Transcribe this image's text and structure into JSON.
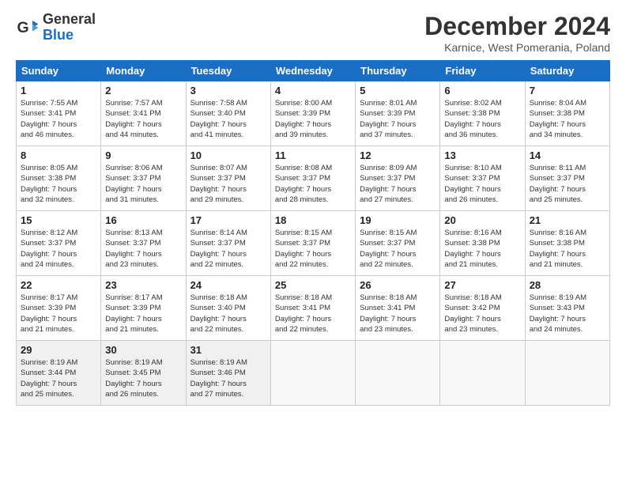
{
  "header": {
    "logo_line1": "General",
    "logo_line2": "Blue",
    "month_title": "December 2024",
    "location": "Karnice, West Pomerania, Poland"
  },
  "days_of_week": [
    "Sunday",
    "Monday",
    "Tuesday",
    "Wednesday",
    "Thursday",
    "Friday",
    "Saturday"
  ],
  "weeks": [
    [
      {
        "day": "1",
        "text": "Sunrise: 7:55 AM\nSunset: 3:41 PM\nDaylight: 7 hours\nand 46 minutes."
      },
      {
        "day": "2",
        "text": "Sunrise: 7:57 AM\nSunset: 3:41 PM\nDaylight: 7 hours\nand 44 minutes."
      },
      {
        "day": "3",
        "text": "Sunrise: 7:58 AM\nSunset: 3:40 PM\nDaylight: 7 hours\nand 41 minutes."
      },
      {
        "day": "4",
        "text": "Sunrise: 8:00 AM\nSunset: 3:39 PM\nDaylight: 7 hours\nand 39 minutes."
      },
      {
        "day": "5",
        "text": "Sunrise: 8:01 AM\nSunset: 3:39 PM\nDaylight: 7 hours\nand 37 minutes."
      },
      {
        "day": "6",
        "text": "Sunrise: 8:02 AM\nSunset: 3:38 PM\nDaylight: 7 hours\nand 36 minutes."
      },
      {
        "day": "7",
        "text": "Sunrise: 8:04 AM\nSunset: 3:38 PM\nDaylight: 7 hours\nand 34 minutes."
      }
    ],
    [
      {
        "day": "8",
        "text": "Sunrise: 8:05 AM\nSunset: 3:38 PM\nDaylight: 7 hours\nand 32 minutes."
      },
      {
        "day": "9",
        "text": "Sunrise: 8:06 AM\nSunset: 3:37 PM\nDaylight: 7 hours\nand 31 minutes."
      },
      {
        "day": "10",
        "text": "Sunrise: 8:07 AM\nSunset: 3:37 PM\nDaylight: 7 hours\nand 29 minutes."
      },
      {
        "day": "11",
        "text": "Sunrise: 8:08 AM\nSunset: 3:37 PM\nDaylight: 7 hours\nand 28 minutes."
      },
      {
        "day": "12",
        "text": "Sunrise: 8:09 AM\nSunset: 3:37 PM\nDaylight: 7 hours\nand 27 minutes."
      },
      {
        "day": "13",
        "text": "Sunrise: 8:10 AM\nSunset: 3:37 PM\nDaylight: 7 hours\nand 26 minutes."
      },
      {
        "day": "14",
        "text": "Sunrise: 8:11 AM\nSunset: 3:37 PM\nDaylight: 7 hours\nand 25 minutes."
      }
    ],
    [
      {
        "day": "15",
        "text": "Sunrise: 8:12 AM\nSunset: 3:37 PM\nDaylight: 7 hours\nand 24 minutes."
      },
      {
        "day": "16",
        "text": "Sunrise: 8:13 AM\nSunset: 3:37 PM\nDaylight: 7 hours\nand 23 minutes."
      },
      {
        "day": "17",
        "text": "Sunrise: 8:14 AM\nSunset: 3:37 PM\nDaylight: 7 hours\nand 22 minutes."
      },
      {
        "day": "18",
        "text": "Sunrise: 8:15 AM\nSunset: 3:37 PM\nDaylight: 7 hours\nand 22 minutes."
      },
      {
        "day": "19",
        "text": "Sunrise: 8:15 AM\nSunset: 3:37 PM\nDaylight: 7 hours\nand 22 minutes."
      },
      {
        "day": "20",
        "text": "Sunrise: 8:16 AM\nSunset: 3:38 PM\nDaylight: 7 hours\nand 21 minutes."
      },
      {
        "day": "21",
        "text": "Sunrise: 8:16 AM\nSunset: 3:38 PM\nDaylight: 7 hours\nand 21 minutes."
      }
    ],
    [
      {
        "day": "22",
        "text": "Sunrise: 8:17 AM\nSunset: 3:39 PM\nDaylight: 7 hours\nand 21 minutes."
      },
      {
        "day": "23",
        "text": "Sunrise: 8:17 AM\nSunset: 3:39 PM\nDaylight: 7 hours\nand 21 minutes."
      },
      {
        "day": "24",
        "text": "Sunrise: 8:18 AM\nSunset: 3:40 PM\nDaylight: 7 hours\nand 22 minutes."
      },
      {
        "day": "25",
        "text": "Sunrise: 8:18 AM\nSunset: 3:41 PM\nDaylight: 7 hours\nand 22 minutes."
      },
      {
        "day": "26",
        "text": "Sunrise: 8:18 AM\nSunset: 3:41 PM\nDaylight: 7 hours\nand 23 minutes."
      },
      {
        "day": "27",
        "text": "Sunrise: 8:18 AM\nSunset: 3:42 PM\nDaylight: 7 hours\nand 23 minutes."
      },
      {
        "day": "28",
        "text": "Sunrise: 8:19 AM\nSunset: 3:43 PM\nDaylight: 7 hours\nand 24 minutes."
      }
    ],
    [
      {
        "day": "29",
        "text": "Sunrise: 8:19 AM\nSunset: 3:44 PM\nDaylight: 7 hours\nand 25 minutes."
      },
      {
        "day": "30",
        "text": "Sunrise: 8:19 AM\nSunset: 3:45 PM\nDaylight: 7 hours\nand 26 minutes."
      },
      {
        "day": "31",
        "text": "Sunrise: 8:19 AM\nSunset: 3:46 PM\nDaylight: 7 hours\nand 27 minutes."
      },
      {
        "day": "",
        "text": ""
      },
      {
        "day": "",
        "text": ""
      },
      {
        "day": "",
        "text": ""
      },
      {
        "day": "",
        "text": ""
      }
    ]
  ]
}
